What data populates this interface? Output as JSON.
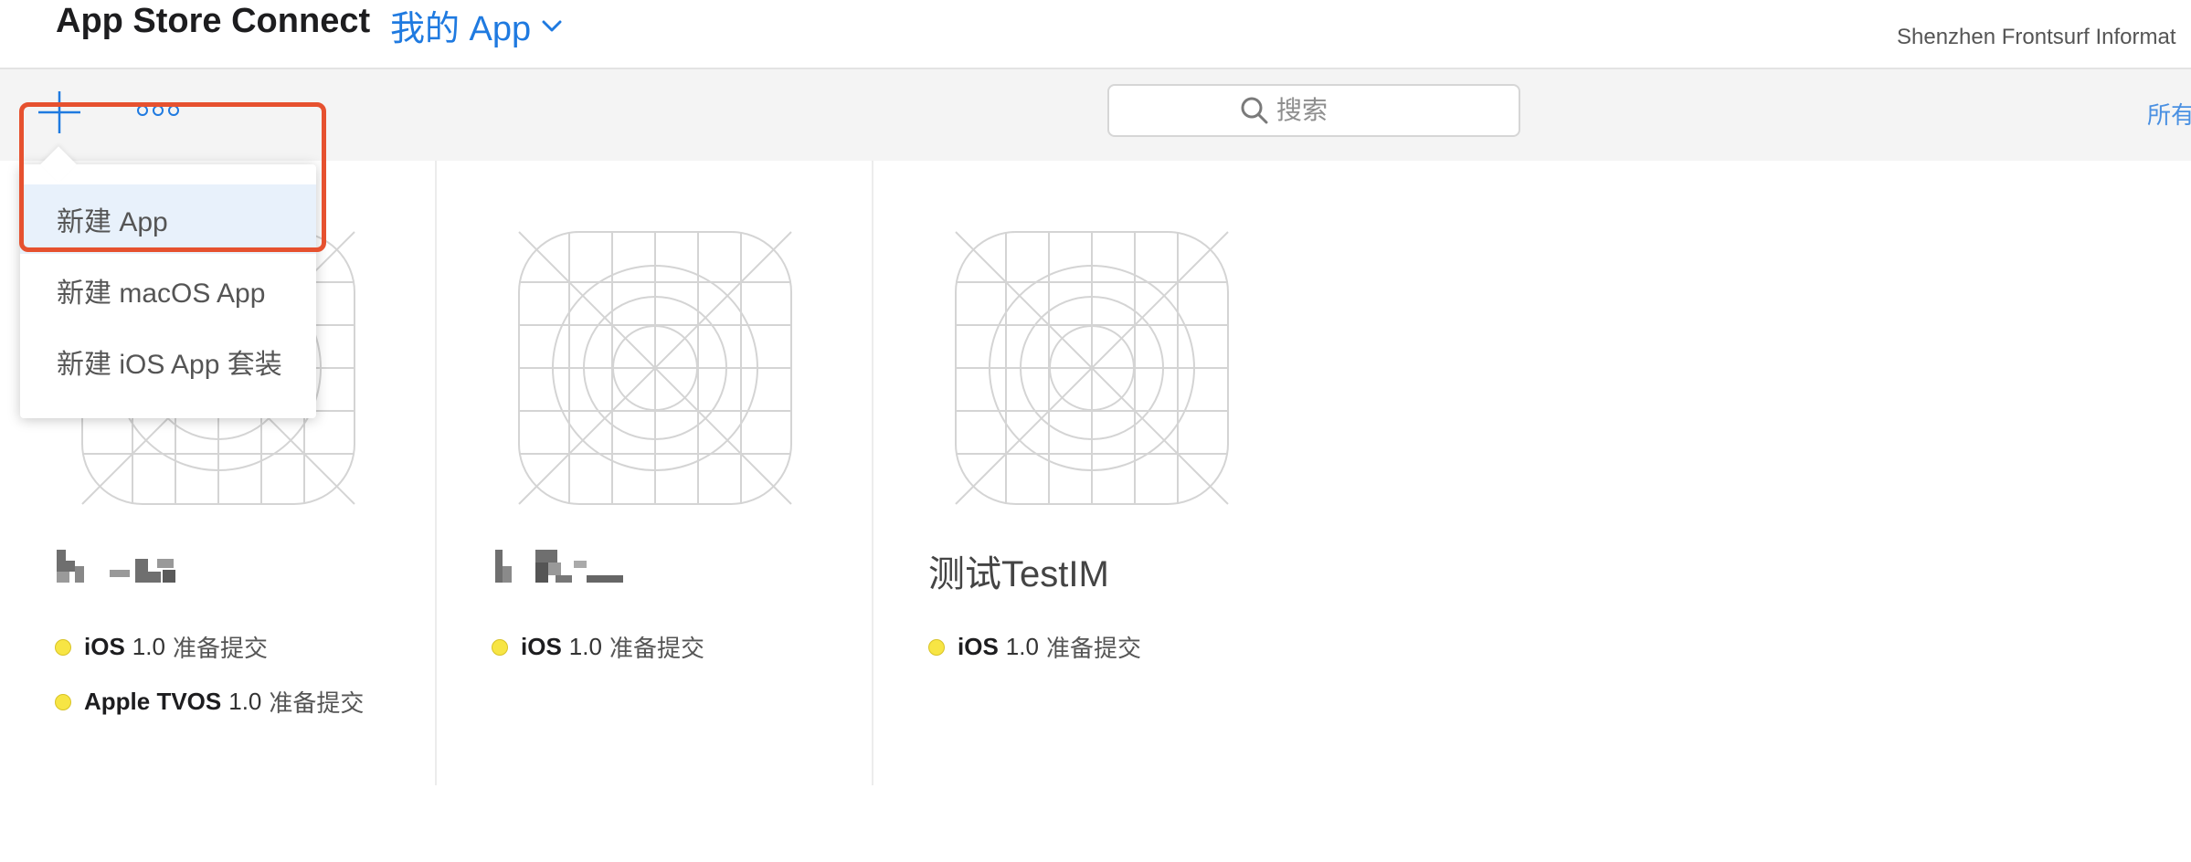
{
  "header": {
    "brand": "App Store Connect",
    "section_menu": "我的 App",
    "account_name": "Shenzhen Frontsurf Informat"
  },
  "toolbar": {
    "add_icon": "plus-icon",
    "more_icon": "ellipsis-icon",
    "search": {
      "placeholder": "搜索",
      "value": ""
    },
    "filter_label": "所有"
  },
  "dropdown": {
    "items": [
      {
        "label": "新建 App",
        "highlighted": true
      },
      {
        "label": "新建 macOS App",
        "highlighted": false
      },
      {
        "label": "新建 iOS App 套装",
        "highlighted": false
      }
    ]
  },
  "apps": [
    {
      "name": "",
      "platforms": [
        {
          "name": "iOS",
          "version": "1.0",
          "status": "准备提交"
        },
        {
          "name": "Apple TVOS",
          "version": "1.0",
          "status": "准备提交"
        }
      ]
    },
    {
      "name": "",
      "platforms": [
        {
          "name": "iOS",
          "version": "1.0",
          "status": "准备提交"
        }
      ]
    },
    {
      "name": "测试TestIM",
      "platforms": [
        {
          "name": "iOS",
          "version": "1.0",
          "status": "准备提交"
        }
      ]
    }
  ],
  "colors": {
    "accent": "#1f7ae0",
    "status_dot": "#f7e544",
    "highlight_border": "#e6512f"
  }
}
